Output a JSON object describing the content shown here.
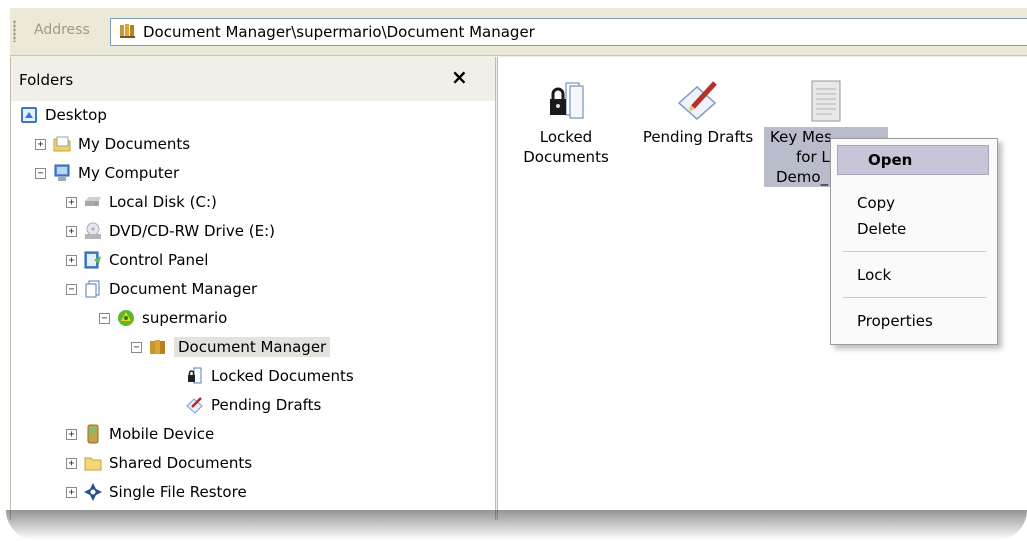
{
  "address": {
    "label": "Address",
    "path": "Document Manager\\supermario\\Document Manager"
  },
  "folders_pane": {
    "title": "Folders",
    "close_glyph": "×"
  },
  "tree": {
    "desktop": "Desktop",
    "my_documents": "My Documents",
    "my_computer": "My Computer",
    "local_disk": "Local Disk (C:)",
    "dvd_drive": "DVD/CD-RW Drive (E:)",
    "control_panel": "Control Panel",
    "document_manager": "Document Manager",
    "supermario": "supermario",
    "document_manager_sub": "Document Manager",
    "locked_documents": "Locked Documents",
    "pending_drafts": "Pending Drafts",
    "mobile_device": "Mobile Device",
    "shared_documents": "Shared Documents",
    "single_file_restore": "Single File Restore",
    "expand_glyph": "+",
    "collapse_glyph": "−"
  },
  "content": {
    "locked_line1": "Locked",
    "locked_line2": "Documents",
    "pending": "Pending Drafts",
    "key_line1": "Key Mes",
    "key_line2": "for L'",
    "key_line3": "Demo_"
  },
  "context_menu": {
    "open": "Open",
    "copy": "Copy",
    "delete": "Delete",
    "lock": "Lock",
    "properties": "Properties"
  },
  "icons": {
    "archive": "document-archive-icon",
    "desktop": "desktop-icon",
    "documents": "my-documents-icon",
    "computer": "my-computer-icon",
    "disk": "hard-disk-icon",
    "dvd": "dvd-drive-icon",
    "control": "control-panel-icon",
    "docmgr": "document-manager-icon",
    "user": "user-green-icon",
    "lock": "locked-documents-icon",
    "pencil": "pending-drafts-icon",
    "mobile": "mobile-device-icon",
    "folder": "shared-folder-icon",
    "restore": "single-file-restore-icon"
  }
}
